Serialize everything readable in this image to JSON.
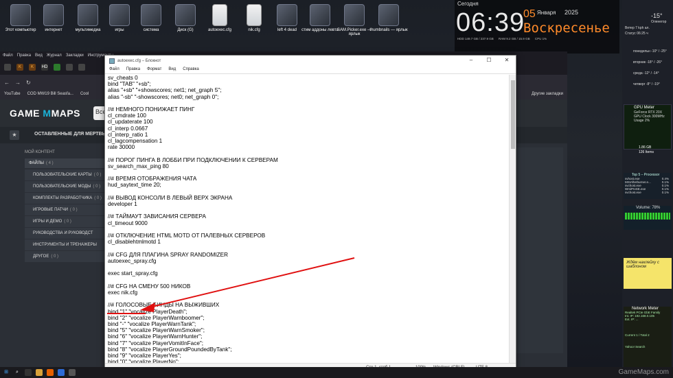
{
  "desktop": {
    "icons": [
      {
        "label": "Этот компьютер"
      },
      {
        "label": "интернет"
      },
      {
        "label": "мультимедиа"
      },
      {
        "label": "игры"
      },
      {
        "label": "система"
      },
      {
        "label": "Диск (G)"
      },
      {
        "label": "autoexec.cfg"
      },
      {
        "label": "nik.cfg"
      },
      {
        "label": "left 4 dead"
      },
      {
        "label": "стим аддоны левта"
      },
      {
        "label": "SAM.Picker.exe — ярлык"
      },
      {
        "label": "thumbnails — ярлык"
      }
    ]
  },
  "clock": {
    "today_label": "Сегодня",
    "time": "06:39",
    "day": "05",
    "month": "Января",
    "year": "2025",
    "weekday": "Воскресенье",
    "stats": [
      "HDD 149.7 GB / 237.9 GB",
      "RAM 9.2 GB / 15.9 GB",
      "CPU 1%"
    ]
  },
  "gadgets": {
    "weather": {
      "temp": "-15°",
      "location": "Оленегор",
      "wind": "Ветер 7 kph ал.",
      "status": "Статус 06:25 ч",
      "forecast": [
        "понедельн -10° / -25°",
        "вторник -18° / -26°",
        "среда -12° / -14°",
        "четверг -8° / -19°"
      ]
    },
    "gpu": {
      "title": "GPU Meter",
      "model": "GeForce RTX 20X",
      "clock": "GPU Clock 300MHz",
      "usage": "Usage 2%"
    },
    "drive": {
      "size": "1.86 GB",
      "files": "126 Items"
    },
    "top5": {
      "title": "Top 5 – Processor",
      "rows": [
        [
          "svhost.exe",
          "0.4%"
        ],
        [
          "MSIAfterburner.e...",
          "0.1%"
        ],
        [
          "svchost.exe",
          "0.1%"
        ],
        [
          "WmiPrvSE.exe",
          "0.1%"
        ],
        [
          "svchost.exe",
          "0.1%"
        ]
      ]
    },
    "volume": {
      "title": "Volume: 78%"
    },
    "note": {
      "text": "Ждём наклейку с шаблоном"
    },
    "net": {
      "title": "Network Meter",
      "lines": [
        "Realtek PCIe GbE Family",
        "Int. IP: 192.168.0.105",
        "Ext. IP: ...",
        "Current 1 / Total 2",
        "Yahoo! Search"
      ]
    }
  },
  "browser": {
    "menu": [
      "Файл",
      "Правка",
      "Вид",
      "Журнал",
      "Закладки",
      "Инструменты"
    ],
    "url_text": "",
    "bookmarks": [
      "YouTube",
      "COD MW19 Bill Seasfa...",
      "Cool"
    ],
    "bookmarks_right": "Другие закладки",
    "logo_game": "GAME",
    "logo_maps": "MAPS",
    "search_prefix": "Все",
    "subnav_label": "ОСТАВЛЕННЫЕ ДЛЯ МЕРТВЫХ",
    "sidebar_title": "МОЙ КОНТЕНТ",
    "sidebar_group": "ФАЙЛЫ",
    "sidebar_group_count": "( 4 )",
    "sidebar_items": [
      {
        "label": "ПОЛЬЗОВАТЕЛЬСКИЕ КАРТЫ",
        "count": "( 0 )"
      },
      {
        "label": "ПОЛЬЗОВАТЕЛЬСКИЕ МОДЫ",
        "count": "( 0 )"
      },
      {
        "label": "КОМПЛЕКТЫ РАЗРАБОТЧИКА",
        "count": "( 0 )"
      },
      {
        "label": "ИГРОВЫЕ ПАТЧИ",
        "count": "( 0 )"
      },
      {
        "label": "ИГРЫ И ДЕМО",
        "count": "( 0 )"
      },
      {
        "label": "РУКОВОДСТВА И РУКОВОДСТ",
        "count": ""
      },
      {
        "label": "ИНСТРУМЕНТЫ И ТРЕНАЖЕРЫ",
        "count": ""
      },
      {
        "label": "ДРУГОЕ",
        "count": "( 0 )"
      }
    ]
  },
  "notepad": {
    "title": "autoexec.cfg – Блокнот",
    "menu": [
      "Файл",
      "Правка",
      "Формат",
      "Вид",
      "Справка"
    ],
    "content": "sv_cheats 0\nbind \"TAB\" \"+sb\";\nalias \"+sb\" \"+showscores; net1; net_graph 5\";\nalias \"-sb\" \"-showscores; net0; net_graph 0\";\n\n//# НЕМНОГО ПОНИЖАЕТ ПИНГ\ncl_cmdrate 100\ncl_updaterate 100\ncl_interp 0.0667\ncl_interp_ratio 1\ncl_lagcompensation 1\nrate 30000\n\n//# ПОРОГ ПИНГА В ЛОББИ ПРИ ПОДКЛЮЧЕНИИ К СЕРВЕРАМ\nsv_search_max_ping 80\n\n//# ВРЕМЯ ОТОБРАЖЕНИЯ ЧАТА\nhud_saytext_time 20;\n\n//# ВЫВОД КОНСОЛИ В ЛЕВЫЙ ВЕРХ ЭКРАНА\ndeveloper 1\n\n//# ТАЙМАУТ ЗАВИСАНИЯ СЕРВЕРА\ncl_timeout 9000\n\n//# ОТКЛЮЧЕНИЕ HTML MOTD ОТ ПАЛЕВНЫХ СЕРВЕРОВ\ncl_disablehtmlmotd 1\n\n//# CFG ДЛЯ ПЛАГИНА SPRAY RANDOMIZER\nautoexec_spray.cfg\n\nexec start_spray.cfg\n\n//# CFG НА СМЕНУ 500 НИКОВ\nexec nik.cfg\n\n//# ГОЛОСОВЫЕ БИНДЫ НА ВЫЖИВШИХ\nbind \"1\" \"vocalize PlayerDeath\";\nbind \"2\" \"vocalize PlayerWarnboomer\";\nbind \"-\" \"vocalize PlayerWarnTank\";\nbind \"5\" \"vocalize PlayerWarnSmoker\";\nbind \"6\" \"vocalize PlayerWarnHunter\";\nbind \"7\" \"vocalize PlayerVomitInFace\";\nbind \"8\" \"vocalize PlayerGroundPoundedByTank\";\nbind \"9\" \"vocalize PlayerYes\";\nbind \"0\" \"vocalize PlayerNo\";",
    "status": {
      "position": "Стр 1, стлб 1",
      "zoom": "100%",
      "eol": "Windows (CRLF)",
      "encoding": "UTF-8"
    }
  },
  "annotation": {
    "color": "#e01010"
  },
  "watermark": "GameMaps.com"
}
